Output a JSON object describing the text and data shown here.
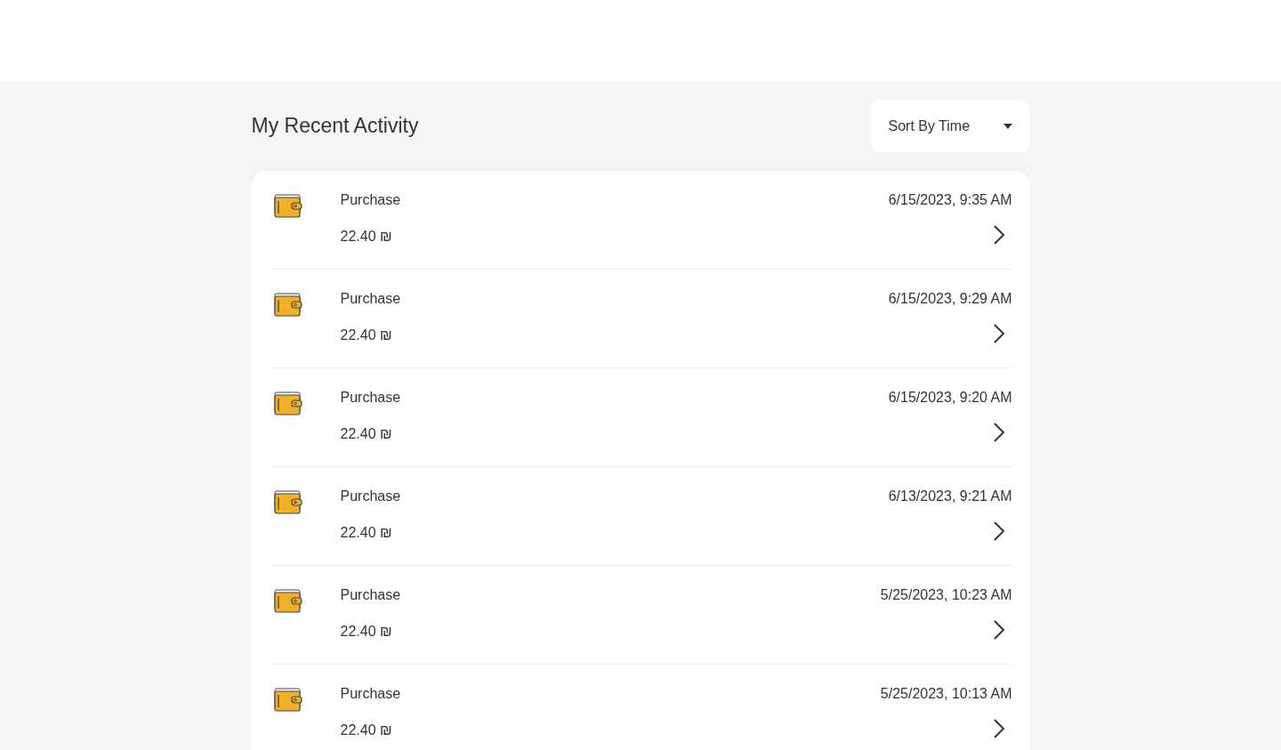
{
  "title": "My Recent Activity",
  "sort": {
    "label": "Sort By Time"
  },
  "activities": [
    {
      "label": "Purchase",
      "amount": "22.40 ₪",
      "time": "6/15/2023, 9:35 AM"
    },
    {
      "label": "Purchase",
      "amount": "22.40 ₪",
      "time": "6/15/2023, 9:29 AM"
    },
    {
      "label": "Purchase",
      "amount": "22.40 ₪",
      "time": "6/15/2023, 9:20 AM"
    },
    {
      "label": "Purchase",
      "amount": "22.40 ₪",
      "time": "6/13/2023, 9:21 AM"
    },
    {
      "label": "Purchase",
      "amount": "22.40 ₪",
      "time": "5/25/2023, 10:23 AM"
    },
    {
      "label": "Purchase",
      "amount": "22.40 ₪",
      "time": "5/25/2023, 10:13 AM"
    }
  ]
}
